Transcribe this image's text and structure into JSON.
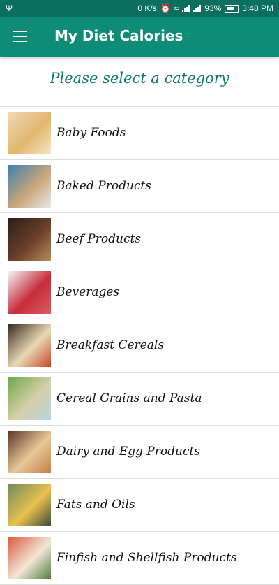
{
  "status_bar": {
    "speed": "0 K/s",
    "battery_percent": "93%",
    "time": "3:48 PM",
    "icons": [
      "usb-icon",
      "alarm-icon",
      "wifi-icon",
      "signal-icon",
      "battery-icon"
    ]
  },
  "app_bar": {
    "title": "My Diet Calories",
    "menu_icon": "hamburger-menu-icon"
  },
  "subtitle": "Please select a category",
  "colors": {
    "status_bar": "#0b6f60",
    "app_bar": "#0f8c78",
    "subtitle": "#0f7a6a"
  },
  "categories": [
    {
      "label": "Baby Foods",
      "thumb_colors": [
        "#f3d7b8",
        "#e0b76c",
        "#f6e6c9"
      ]
    },
    {
      "label": "Baked Products",
      "thumb_colors": [
        "#3b7fb4",
        "#c9a679",
        "#e8e8e8"
      ]
    },
    {
      "label": "Beef Products",
      "thumb_colors": [
        "#2a1f18",
        "#6b3f29",
        "#b78c5a"
      ]
    },
    {
      "label": "Beverages",
      "thumb_colors": [
        "#f4f4f4",
        "#c62d3c",
        "#d95c63"
      ]
    },
    {
      "label": "Breakfast Cereals",
      "thumb_colors": [
        "#3a2b22",
        "#e9d9b5",
        "#c9442b"
      ]
    },
    {
      "label": "Cereal Grains and Pasta",
      "thumb_colors": [
        "#6fa84d",
        "#d7cfa9",
        "#b4d7e0"
      ]
    },
    {
      "label": "Dairy and Egg Products",
      "thumb_colors": [
        "#5a3724",
        "#e8c79a",
        "#c47e45"
      ]
    },
    {
      "label": "Fats and Oils",
      "thumb_colors": [
        "#6f8a5e",
        "#e9c04f",
        "#3c4a3c"
      ]
    },
    {
      "label": "Finfish and Shellfish Products",
      "thumb_colors": [
        "#d85a3a",
        "#f2e7d8",
        "#4a7f3b"
      ]
    }
  ]
}
